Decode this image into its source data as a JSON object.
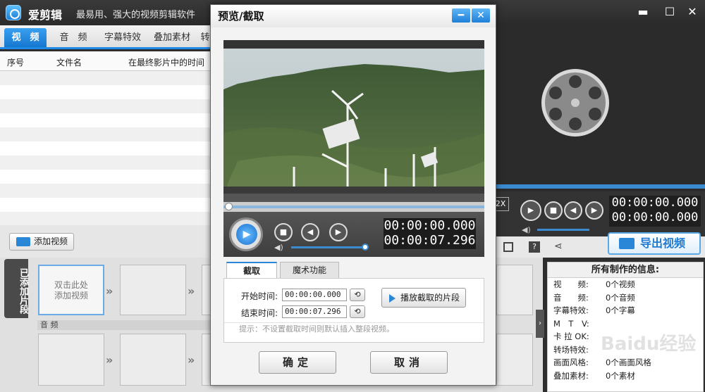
{
  "app": {
    "title": "爱剪辑",
    "slogan": "最易用、强大的视频剪辑软件",
    "min": "▬",
    "max": "☐",
    "close": "✕"
  },
  "tabs": [
    {
      "label": "视　频"
    },
    {
      "label": "音　频"
    },
    {
      "label": "字幕特效"
    },
    {
      "label": "叠加素材"
    },
    {
      "label": "转"
    }
  ],
  "list": {
    "col_index": "序号",
    "col_filename": "文件名",
    "col_time": "在最终影片中的时间"
  },
  "add_video": "添加视频",
  "side_tab": "已添加片段",
  "first_clip": "双击此处\n添加视频",
  "audio_label": "音 频",
  "right_player": {
    "speed": "2X",
    "time_top": "00:00:00.000",
    "time_bottom": "00:00:00.000"
  },
  "export": "导出视频",
  "info": {
    "title": "所有制作的信息:",
    "rows": [
      {
        "k": "视　　频:",
        "v": "0个视频"
      },
      {
        "k": "音　　频:",
        "v": "0个音频"
      },
      {
        "k": "字幕特效:",
        "v": "0个字幕"
      },
      {
        "k": "M　T　V:",
        "v": ""
      },
      {
        "k": "卡 拉 OK:",
        "v": ""
      },
      {
        "k": "转场特效:",
        "v": ""
      },
      {
        "k": "画面风格:",
        "v": "0个画面风格"
      },
      {
        "k": "叠加素材:",
        "v": "0个素材"
      }
    ]
  },
  "dialog": {
    "title": "预览/截取",
    "min": "━",
    "close": "✕",
    "time_current": "00:00:00.000",
    "time_total": "00:00:07.296",
    "tab_cut": "截取",
    "tab_magic": "魔术功能",
    "start_label": "开始时间:",
    "start_value": "00:00:00.000",
    "end_label": "结束时间:",
    "end_value": "00:00:07.296",
    "play_clip": "播放截取的片段",
    "tip": "提示：不设置截取时间则默认插入整段视频。",
    "ok": "确定",
    "cancel": "取消"
  },
  "watermark": "Baidu经验"
}
